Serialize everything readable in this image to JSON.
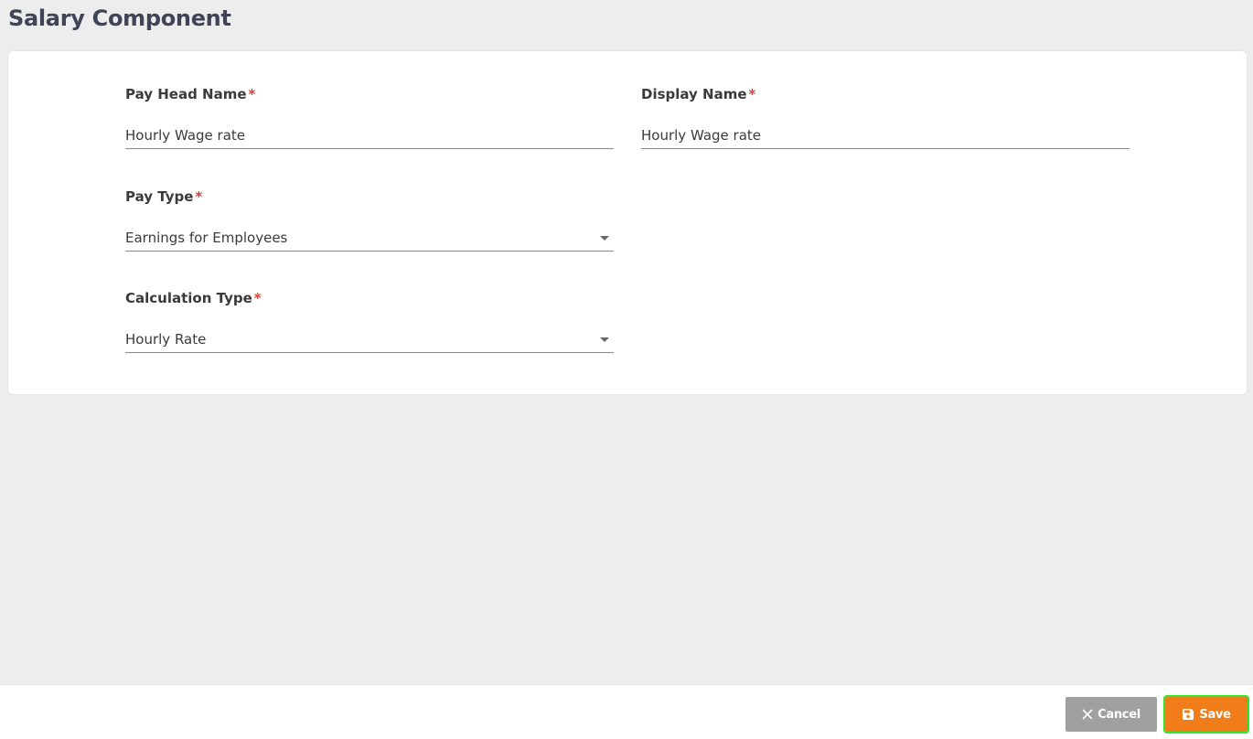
{
  "page": {
    "title": "Salary Component"
  },
  "form": {
    "required_marker": "*",
    "pay_head_name": {
      "label": "Pay Head Name",
      "value": "Hourly Wage rate"
    },
    "display_name": {
      "label": "Display Name",
      "value": "Hourly Wage rate"
    },
    "pay_type": {
      "label": "Pay Type",
      "selected": "Earnings for Employees"
    },
    "calculation_type": {
      "label": "Calculation Type",
      "selected": "Hourly Rate"
    }
  },
  "footer": {
    "cancel_label": "Cancel",
    "cancel_icon": "close-icon",
    "save_label": "Save",
    "save_icon": "floppy-disk-icon"
  },
  "colors": {
    "accent": "#f07d1a",
    "cancel": "#a0a0a0",
    "required": "#e53935",
    "title": "#3f4456"
  }
}
